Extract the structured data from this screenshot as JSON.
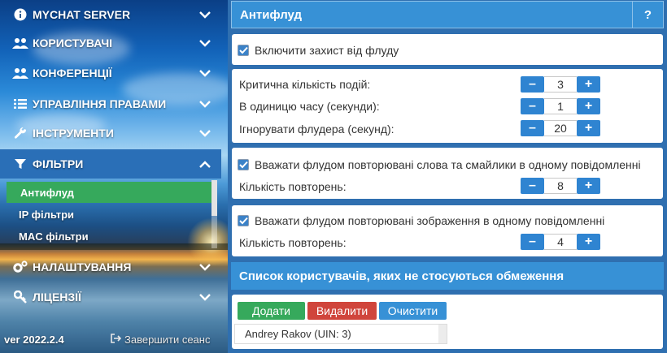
{
  "sidebar": {
    "items": [
      {
        "label": "MYCHAT SERVER",
        "icon": "info-icon"
      },
      {
        "label": "КОРИСТУВАЧІ",
        "icon": "users-icon"
      },
      {
        "label": "КОНФЕРЕНЦІЇ",
        "icon": "users-icon"
      },
      {
        "label": "УПРАВЛІННЯ ПРАВАМИ",
        "icon": "list-icon"
      },
      {
        "label": "ІНСТРУМЕНТИ",
        "icon": "wrench-icon"
      },
      {
        "label": "ФІЛЬТРИ",
        "icon": "filter-icon"
      },
      {
        "label": "НАЛАШТУВАННЯ",
        "icon": "gear-icon"
      },
      {
        "label": "ЛІЦЕНЗІЇ",
        "icon": "key-icon"
      }
    ],
    "subitems": [
      {
        "label": "Антифлуд"
      },
      {
        "label": "IP фільтри"
      },
      {
        "label": "MAC фільтри"
      }
    ],
    "version": "ver 2022.2.4",
    "logout_label": "Завершити сеанс"
  },
  "main": {
    "title": "Антифлуд",
    "help_label": "?",
    "enable_label": "Включити захист від флуду",
    "fields": [
      {
        "label": "Критична кількість подій:",
        "value": "3"
      },
      {
        "label": "В одиницю часу (секунди):",
        "value": "1"
      },
      {
        "label": "Ігнорувати флудера (секунд):",
        "value": "20"
      }
    ],
    "repeat_words": {
      "label": "Вважати флудом повторювані слова та смайлики в одному повідомленні",
      "count_label": "Кількість повторень:",
      "count": "8"
    },
    "repeat_images": {
      "label": "Вважати флудом повторювані зображення в одному повідомленні",
      "count_label": "Кількість повторень:",
      "count": "4"
    },
    "minus_label": "–",
    "plus_label": "+",
    "exceptions": {
      "title": "Список користувачів, яких не стосуються обмеження",
      "add_label": "Додати",
      "remove_label": "Видалити",
      "clear_label": "Очистити",
      "users": [
        "Andrey Rakov (UIN: 3)"
      ]
    }
  },
  "colors": {
    "accent": "#3791d6",
    "active_sub": "#36a95c",
    "add": "#36a95c",
    "remove": "#d0453c",
    "clear": "#3791d6"
  }
}
